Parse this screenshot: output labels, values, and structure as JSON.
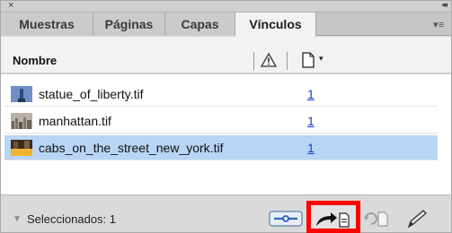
{
  "titlebar": {
    "close_symbol": "×",
    "collapse_symbol": "◂◂"
  },
  "tabs": [
    {
      "label": "Muestras"
    },
    {
      "label": "Páginas"
    },
    {
      "label": "Capas"
    },
    {
      "label": "Vínculos"
    }
  ],
  "active_tab": "Vínculos",
  "panel_menu_symbol": "▾≡",
  "header": {
    "name_label": "Nombre",
    "status_icon": "warning-icon",
    "page_icon": "page-icon",
    "caret": "▾"
  },
  "links": [
    {
      "name": "statue_of_liberty.tif",
      "page": "1",
      "selected": false,
      "thumb": "statue-thumbnail-icon"
    },
    {
      "name": "manhattan.tif",
      "page": "1",
      "selected": false,
      "thumb": "skyline-thumbnail-icon"
    },
    {
      "name": "cabs_on_the_street_new_york.tif",
      "page": "1",
      "selected": true,
      "thumb": "street-thumbnail-icon"
    }
  ],
  "footer": {
    "disclosure": "▼",
    "selection_text": "Seleccionados: 1",
    "buttons": [
      "relink-from-cc-icon",
      "go-to-link-icon",
      "update-link-icon",
      "edit-original-icon"
    ]
  },
  "colors": {
    "highlight_box": "#ff0000",
    "selected_row": "#b8d5f5",
    "link_number": "#1a3cc8"
  }
}
